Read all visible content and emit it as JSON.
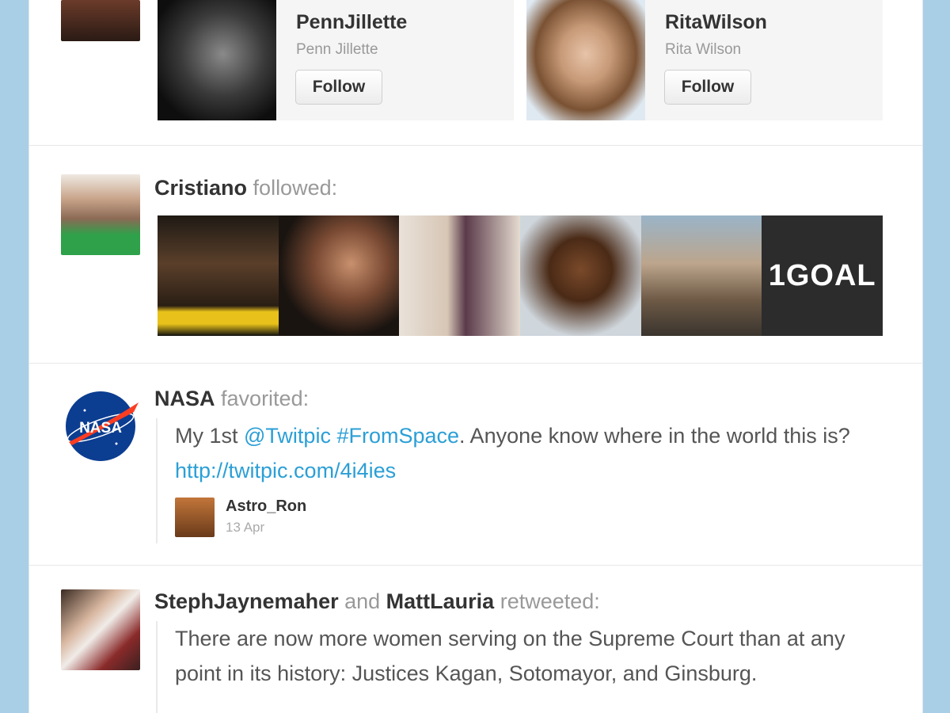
{
  "suggestions": [
    {
      "username": "PennJillette",
      "fullname": "Penn Jillette",
      "button": "Follow"
    },
    {
      "username": "RitaWilson",
      "fullname": "Rita Wilson",
      "button": "Follow"
    }
  ],
  "followed_item": {
    "actor": "Cristiano",
    "action": "followed:",
    "logo_text": "1GOAL"
  },
  "favorited_item": {
    "actor": "NASA",
    "action": "favorited:",
    "logo_text": "NASA",
    "tweet": {
      "text_prefix": "My 1st ",
      "mention": "@Twitpic",
      "space1": " ",
      "hashtag": "#FromSpace",
      "text_middle": ". Anyone know where in the world this is? ",
      "url": "http://twitpic.com/4i4ies",
      "author": "Astro_Ron",
      "date": "13 Apr"
    }
  },
  "retweeted_item": {
    "actor1": "StephJaynemaher",
    "conjunction": " and ",
    "actor2": "MattLauria",
    "action": " retweeted:",
    "tweet_text": "There are now more women serving on the Supreme Court than at any point in its history: Justices Kagan, Sotomayor, and Ginsburg."
  },
  "colors": {
    "background": "#a9cfe6",
    "link": "#2b9fd6",
    "nasa_blue": "#0b3d91",
    "nasa_red": "#fc3d21"
  }
}
